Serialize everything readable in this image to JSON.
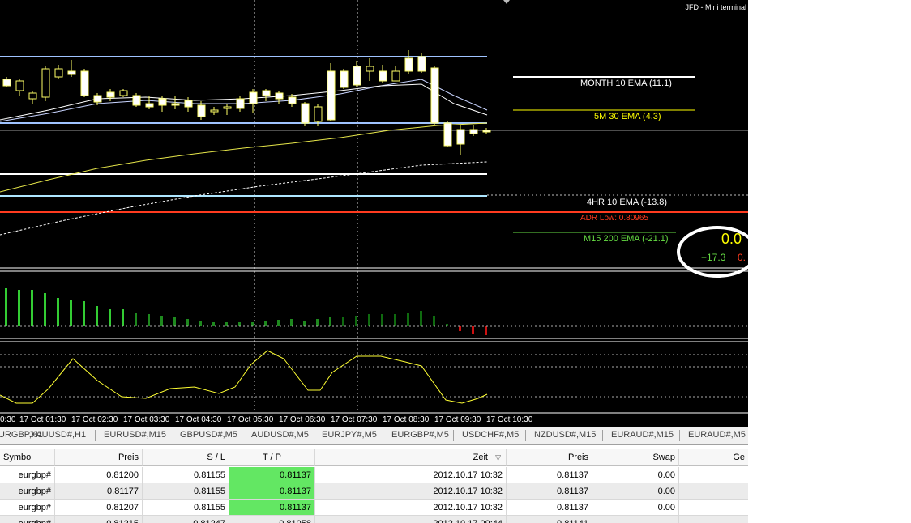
{
  "window": {
    "title": "JFD - Mini terminal"
  },
  "levels": {
    "month_ema": "MONTH 10 EMA (11.1)",
    "m5_ema": "5M 30 EMA (4.3)",
    "hr4_ema": "4HR 10 EMA (-13.8)",
    "adr_low": "ADR Low: 0.80965",
    "m15_ema": "M15 200 EMA (-21.1)"
  },
  "pips": {
    "big": "0.0",
    "green": "+17.3",
    "red": "0."
  },
  "time_axis": [
    "0:30",
    "17 Oct 01:30",
    "17 Oct 02:30",
    "17 Oct 03:30",
    "17 Oct 04:30",
    "17 Oct 05:30",
    "17 Oct 06:30",
    "17 Oct 07:30",
    "17 Oct 08:30",
    "17 Oct 09:30",
    "17 Oct 10:30"
  ],
  "tabs": [
    "URGBP,H1",
    "XAUUSD#,H1",
    "EURUSD#,M15",
    "GBPUSD#,M5",
    "AUDUSD#,M5",
    "EURJPY#,M5",
    "EURGBP#,M5",
    "USDCHF#,M5",
    "NZDUSD#,M15",
    "EURAUD#,M15",
    "EURAUD#,M5"
  ],
  "table": {
    "headers": [
      "Symbol",
      "Preis",
      "S / L",
      "T / P",
      "Zeit",
      "Preis",
      "Swap",
      "Ge"
    ],
    "sort_icon": "▽",
    "rows": [
      [
        "eurgbp#",
        "0.81200",
        "0.81155",
        "0.81137",
        "2012.10.17 10:32",
        "0.81137",
        "0.00",
        ""
      ],
      [
        "eurgbp#",
        "0.81177",
        "0.81155",
        "0.81137",
        "2012.10.17 10:32",
        "0.81137",
        "0.00",
        ""
      ],
      [
        "eurgbp#",
        "0.81207",
        "0.81155",
        "0.81137",
        "2012.10.17 10:32",
        "0.81137",
        "0.00",
        ""
      ],
      [
        "eurgbp#",
        "0.81215",
        "0.81247",
        "0.81058",
        "2012.10.17 09:44",
        "0.81141",
        "",
        ""
      ]
    ]
  },
  "colors": {
    "background": "#000000",
    "bull": "#ffff00",
    "bear": "#ffffff",
    "tp_highlight": "#63e763",
    "adr": "#ff3b1f",
    "level_blue": "#9fc3ff"
  }
}
